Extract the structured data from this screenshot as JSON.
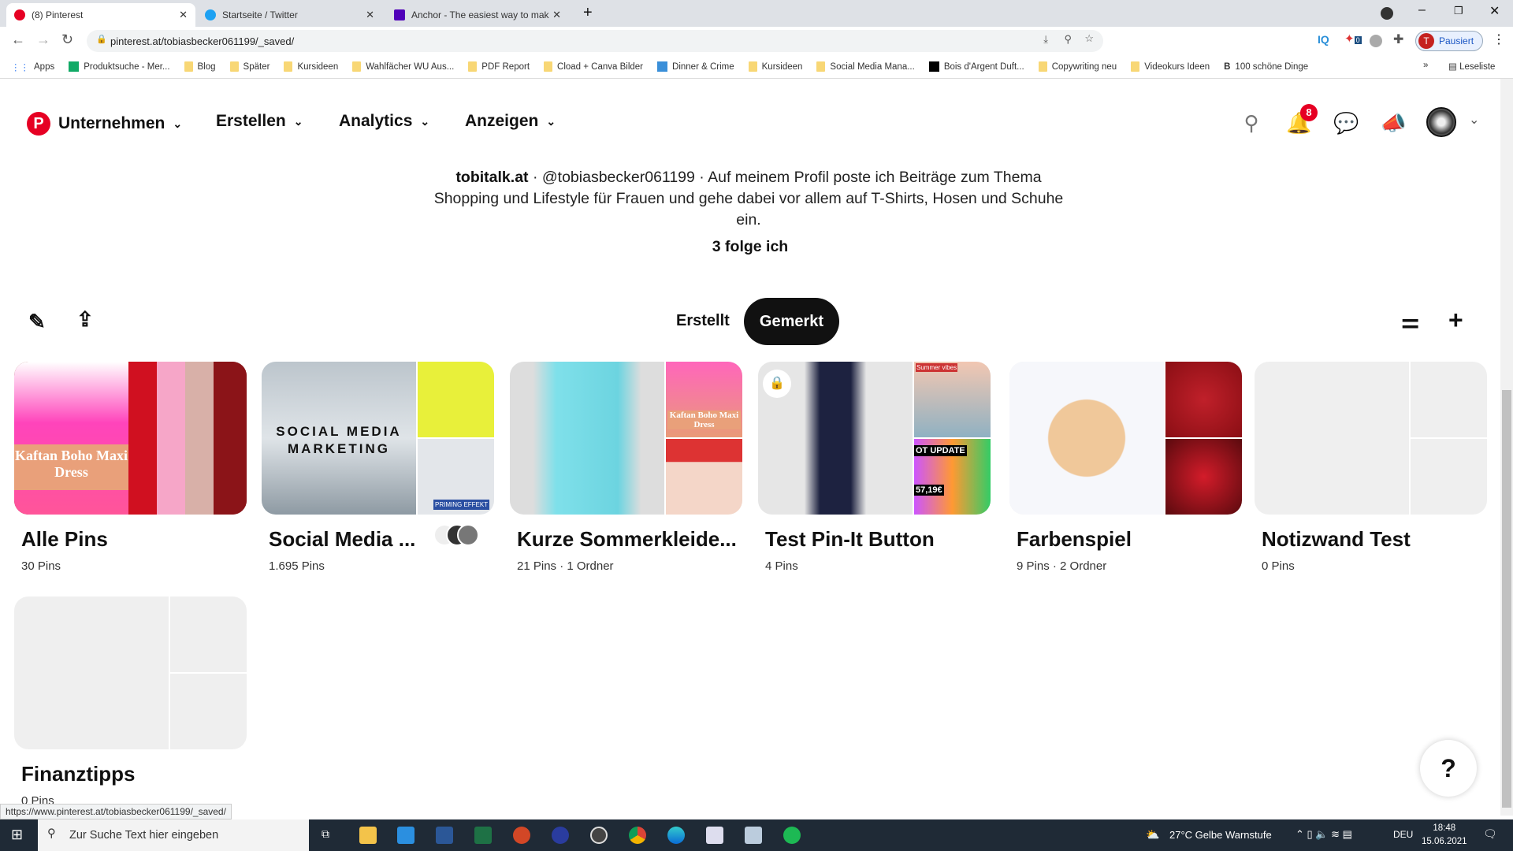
{
  "browser": {
    "tabs": [
      {
        "title": "(8) Pinterest",
        "active": true
      },
      {
        "title": "Startseite / Twitter"
      },
      {
        "title": "Anchor - The easiest way to mak"
      }
    ],
    "url": "pinterest.at/tobiasbecker061199/_saved/",
    "profile_label": "Pausiert",
    "profile_initial": "T",
    "extension_badge": "0",
    "bookmarks": [
      "Apps",
      "Produktsuche - Mer...",
      "Blog",
      "Später",
      "Kursideen",
      "Wahlfächer WU Aus...",
      "PDF Report",
      "Cload + Canva Bilder",
      "Dinner & Crime",
      "Kursideen",
      "Social Media Mana...",
      "Bois d'Argent Duft...",
      "Copywriting neu",
      "Videokurs Ideen",
      "100 schöne Dinge"
    ],
    "overflow": "»",
    "reading_list": "Leseliste"
  },
  "nav": {
    "items": [
      "Unternehmen",
      "Erstellen",
      "Analytics",
      "Anzeigen"
    ],
    "notification_count": "8",
    "brand_color": "#e60023"
  },
  "profile": {
    "name": "tobitalk.at",
    "handle": "@tobiasbecker061199",
    "bio": "Auf meinem Profil poste ich Beiträge zum Thema Shopping und Lifestyle für Frauen und gehe dabei vor allem auf T-Shirts, Hosen und Schuhe ein.",
    "following": "3 folge ich"
  },
  "tabs": {
    "created": "Erstellt",
    "saved": "Gemerkt"
  },
  "boards": [
    {
      "title": "Alle Pins",
      "count": "30 Pins"
    },
    {
      "title": "Social Media ...",
      "count": "1.695 Pins"
    },
    {
      "title": "Kurze Sommerkleide...",
      "count": "21 Pins · 1 Ordner"
    },
    {
      "title": "Test Pin-It Button",
      "count": "4 Pins",
      "secret": true
    },
    {
      "title": "Farbenspiel",
      "count": "9 Pins · 2 Ordner"
    },
    {
      "title": "Notizwand Test",
      "count": "0 Pins"
    },
    {
      "title": "Finanztipps",
      "count": "0 Pins"
    }
  ],
  "cover_text": {
    "kaftan": "Kaftan Boho Maxi Dress",
    "smm": "SOCIAL MEDIA MARKETING",
    "priming": "PRIMING EFFEKT",
    "summer": "Summer vibes",
    "update": "OT UPDATE",
    "price": "57,19€"
  },
  "help": "?",
  "status_url": "https://www.pinterest.at/tobiasbecker061199/_saved/",
  "taskbar": {
    "search_placeholder": "Zur Suche Text hier eingeben",
    "weather": "27°C  Gelbe Warnstufe",
    "lang": "DEU",
    "time": "18:48",
    "date": "15.06.2021"
  }
}
